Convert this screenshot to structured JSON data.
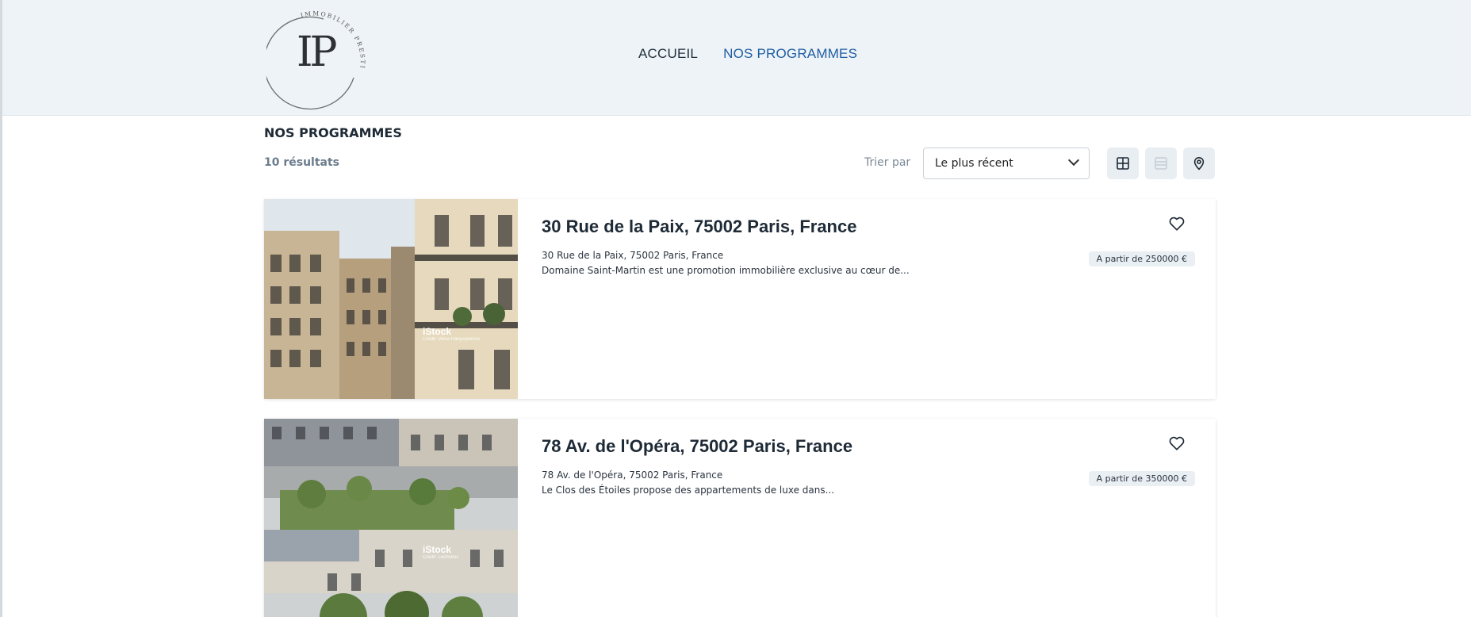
{
  "brand": {
    "monogram": "IP",
    "ring_text": "IMMOBILIER PRESTIGE"
  },
  "nav": {
    "items": [
      {
        "label": "ACCUEIL",
        "active": false
      },
      {
        "label": "NOS PROGRAMMES",
        "active": true
      }
    ]
  },
  "listing": {
    "title": "NOS PROGRAMMES",
    "result_count": "10 résultats",
    "sort_label": "Trier par",
    "sort_value": "Le plus récent"
  },
  "view_modes": [
    {
      "name": "grid-view-icon",
      "active": true
    },
    {
      "name": "list-view-icon",
      "active": false
    },
    {
      "name": "map-pin-icon",
      "active": true
    }
  ],
  "programmes": [
    {
      "title": "30 Rue de la Paix, 75002 Paris, France",
      "address": "30 Rue de la Paix, 75002 Paris, France",
      "description": "Domaine Saint-Martin est une promotion immobilière exclusive au cœur de...",
      "price": "A partir de 250000 €",
      "watermark": "iStock",
      "credit": "Credit: Vasia Hakyupukova"
    },
    {
      "title": "78 Av. de l'Opéra, 75002 Paris, France",
      "address": "78 Av. de l'Opéra, 75002 Paris, France",
      "description": "Le Clos des Étoiles propose des appartements de luxe dans...",
      "price": "A partir de 350000 €",
      "watermark": "iStock",
      "credit": "Credit: Leonsbox"
    }
  ],
  "colors": {
    "header_bg": "#eef3f7",
    "nav_active": "#1f5ea3",
    "text_dark": "#1e2a36",
    "muted": "#6b7c8c",
    "price_bg": "#eaeff3"
  }
}
